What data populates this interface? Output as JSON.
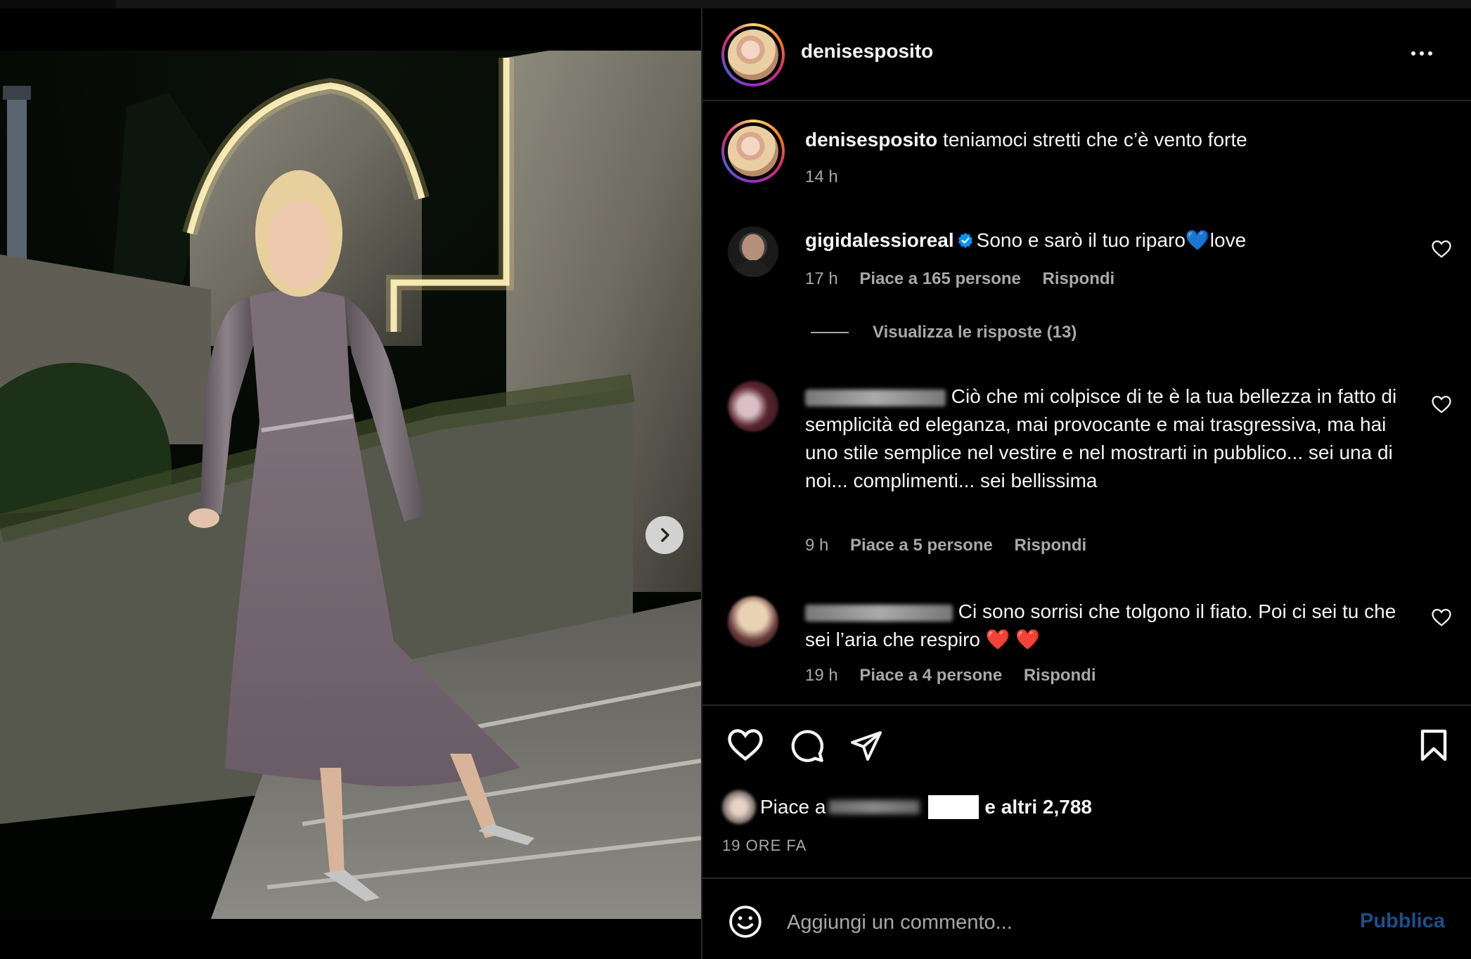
{
  "post": {
    "username": "denisesposito",
    "caption_text": "teniamoci stretti che c’è vento forte",
    "caption_time": "14 h"
  },
  "comments": [
    {
      "username": "gigidalessioreal",
      "verified": true,
      "text": "Sono e sarò il tuo riparo💙love",
      "time": "17 h",
      "likes": "Piace a 165 persone",
      "reply": "Rispondi",
      "view_replies": "Visualizza le risposte (13)"
    },
    {
      "username_redacted": true,
      "text": "Ciò che mi colpisce di te è la tua bellezza in fatto di semplicità ed eleganza, mai provocante e mai trasgressiva, ma hai uno stile semplice nel vestire e nel mostrarti in pubblico... sei una di noi... complimenti... sei bellissima",
      "time": "9 h",
      "likes": "Piace a 5 persone",
      "reply": "Rispondi"
    },
    {
      "username_redacted": true,
      "text": "Ci sono sorrisi che tolgono il fiato. Poi ci sei tu che sei l’aria che respiro ❤️ ❤️",
      "time": "19 h",
      "likes": "Piace a 4 persone",
      "reply": "Rispondi"
    }
  ],
  "likes_summary": {
    "prefix": "Piace a",
    "suffix": "e altri 2,788"
  },
  "time_ago": "19 ORE FA",
  "add_comment": {
    "placeholder": "Aggiungi un commento...",
    "publish": "Pubblica"
  },
  "carousel": {
    "current_index": 1,
    "total": 2
  },
  "colors": {
    "background": "#000000",
    "text": "#f5f5f5",
    "secondary_text": "#a8a8a8",
    "divider": "#262626",
    "publish_disabled": "#1f4e8a",
    "verified": "#0095f6"
  },
  "icons": [
    "more-options-icon",
    "heart-icon",
    "comment-icon",
    "share-icon",
    "bookmark-icon",
    "emoji-icon",
    "chevron-right-icon",
    "verified-badge-icon"
  ]
}
